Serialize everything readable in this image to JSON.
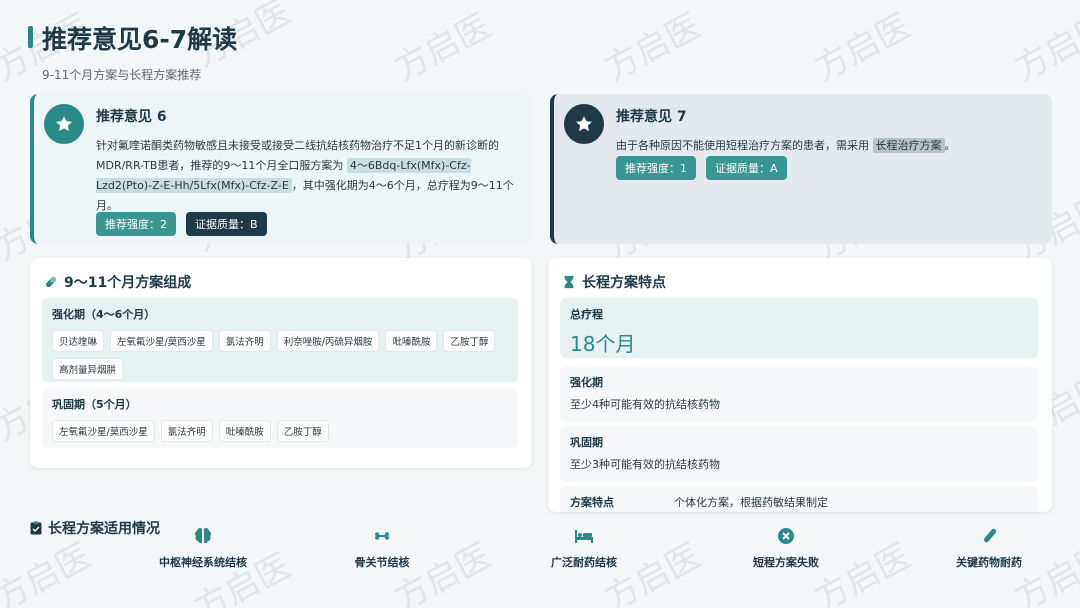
{
  "header": {
    "title": "推荐意见6-7解读",
    "subtitle": "9-11个月方案与长程方案推荐"
  },
  "watermark": "方启医",
  "rec6": {
    "title": "推荐意见 6",
    "body_pre": "针对氟喹诺酮类药物敏感且未接受或接受二线抗结核药物治疗不足1个月的新诊断的MDR/RR-TB患者，推荐的9～11个月全口服方案为 ",
    "regimen": "4～6Bdq-Lfx(Mfx)-Cfz-Lzd2(Pto)-Z-E-Hh/5Lfx(Mfx)-Cfz-Z-E",
    "body_post": "，其中强化期为4～6个月，总疗程为9～11个月。",
    "strength": "推荐强度：2",
    "quality": "证据质量：B"
  },
  "rec7": {
    "title": "推荐意见 7",
    "body_pre": "由于各种原因不能使用短程治疗方案的患者，需采用 ",
    "highlight": "长程治疗方案",
    "body_post": "。",
    "strength": "推荐强度：1",
    "quality": "证据质量：A"
  },
  "composition": {
    "title": "9～11个月方案组成",
    "phase1": {
      "title": "强化期（4～6个月）",
      "drugs": [
        "贝达喹啉",
        "左氧氟沙星/莫西沙星",
        "氯法齐明",
        "利奈唑胺/丙硫异烟胺",
        "吡嗪酰胺",
        "乙胺丁醇",
        "高剂量异烟肼"
      ]
    },
    "phase2": {
      "title": "巩固期（5个月）",
      "drugs": [
        "左氧氟沙星/莫西沙星",
        "氯法齐明",
        "吡嗪酰胺",
        "乙胺丁醇"
      ]
    }
  },
  "features": {
    "title": "长程方案特点",
    "total_label": "总疗程",
    "total_value": "18个月",
    "intensive_label": "强化期",
    "intensive_text": "至少4种可能有效的抗结核药物",
    "consolidation_label": "巩固期",
    "consolidation_text": "至少3种可能有效的抗结核药物",
    "trait_label": "方案特点",
    "trait_text": "个体化方案，根据药敏结果制定"
  },
  "applicability": {
    "title": "长程方案适用情况",
    "items": [
      {
        "label": "中枢神经系统结核",
        "icon": "brain-icon"
      },
      {
        "label": "骨关节结核",
        "icon": "bone-icon"
      },
      {
        "label": "广泛耐药结核",
        "icon": "hospital-bed-icon"
      },
      {
        "label": "短程方案失败",
        "icon": "x-circle-icon"
      },
      {
        "label": "关键药物耐药",
        "icon": "test-tube-icon"
      }
    ]
  },
  "colors": {
    "teal": "#2a8a88",
    "dark": "#1f3a46"
  }
}
